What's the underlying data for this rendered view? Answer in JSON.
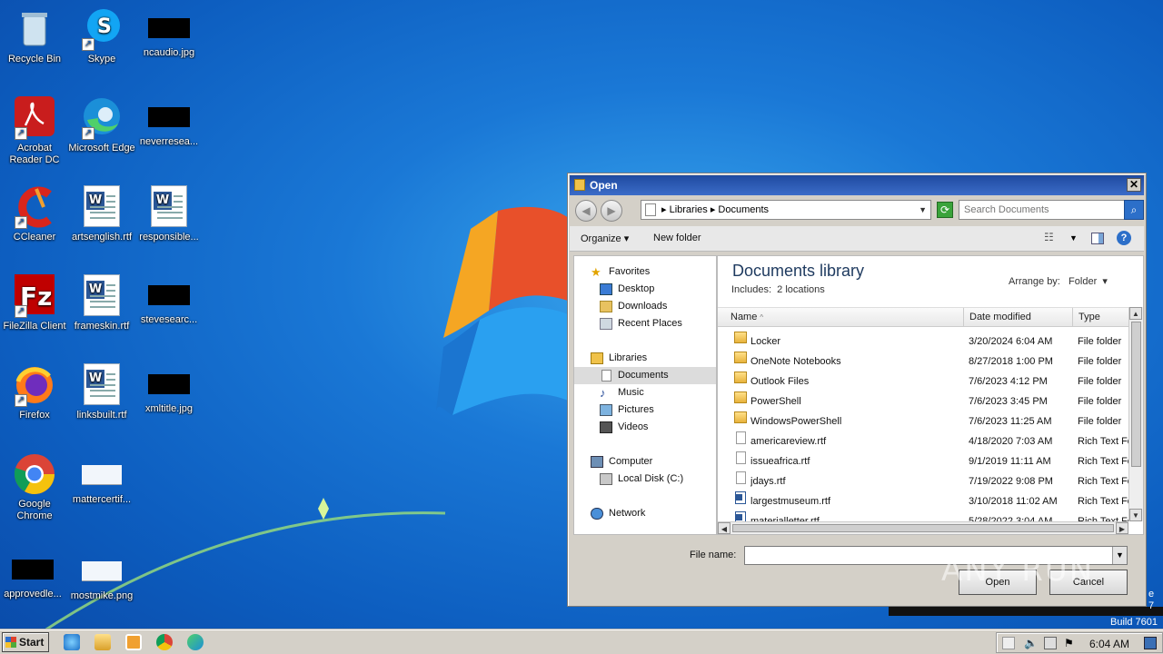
{
  "desktop": {
    "icons": [
      {
        "label": "Recycle Bin"
      },
      {
        "label": "Skype"
      },
      {
        "label": "ncaudio.jpg"
      },
      {
        "label": "Acrobat Reader DC"
      },
      {
        "label": "Microsoft Edge"
      },
      {
        "label": "neverresea..."
      },
      {
        "label": "CCleaner"
      },
      {
        "label": "artsenglish.rtf"
      },
      {
        "label": "responsible..."
      },
      {
        "label": "FileZilla Client"
      },
      {
        "label": "frameskin.rtf"
      },
      {
        "label": "stevesearc..."
      },
      {
        "label": "Firefox"
      },
      {
        "label": "linksbuilt.rtf"
      },
      {
        "label": "xmltitle.jpg"
      },
      {
        "label": "Google Chrome"
      },
      {
        "label": "mattercertif..."
      },
      {
        "label": "approvedle..."
      },
      {
        "label": "mostmike.png"
      }
    ]
  },
  "dialog": {
    "title": "Open",
    "close": "✕",
    "breadcrumb": [
      "Libraries",
      "Documents"
    ],
    "search_placeholder": "Search Documents",
    "toolbar": {
      "organize": "Organize",
      "new_folder": "New folder"
    },
    "nav": {
      "favorites": "Favorites",
      "desktop": "Desktop",
      "downloads": "Downloads",
      "recent": "Recent Places",
      "libraries": "Libraries",
      "documents": "Documents",
      "music": "Music",
      "pictures": "Pictures",
      "videos": "Videos",
      "computer": "Computer",
      "local_disk": "Local Disk (C:)",
      "network": "Network"
    },
    "library": {
      "title": "Documents library",
      "includes_label": "Includes:",
      "includes_value": "2 locations",
      "arrange_label": "Arrange by:",
      "arrange_value": "Folder"
    },
    "columns": {
      "name": "Name",
      "date": "Date modified",
      "type": "Type"
    },
    "files": [
      {
        "name": "Locker",
        "date": "3/20/2024 6:04 AM",
        "type": "File folder",
        "icon": "folder"
      },
      {
        "name": "OneNote Notebooks",
        "date": "8/27/2018 1:00 PM",
        "type": "File folder",
        "icon": "folder"
      },
      {
        "name": "Outlook Files",
        "date": "7/6/2023 4:12 PM",
        "type": "File folder",
        "icon": "folder"
      },
      {
        "name": "PowerShell",
        "date": "7/6/2023 3:45 PM",
        "type": "File folder",
        "icon": "folder"
      },
      {
        "name": "WindowsPowerShell",
        "date": "7/6/2023 11:25 AM",
        "type": "File folder",
        "icon": "folder"
      },
      {
        "name": "americareview.rtf",
        "date": "4/18/2020 7:03 AM",
        "type": "Rich Text Fo",
        "icon": "rtf"
      },
      {
        "name": "issueafrica.rtf",
        "date": "9/1/2019 11:11 AM",
        "type": "Rich Text Fo",
        "icon": "rtf"
      },
      {
        "name": "jdays.rtf",
        "date": "7/19/2022 9:08 PM",
        "type": "Rich Text Fo",
        "icon": "rtf"
      },
      {
        "name": "largestmuseum.rtf",
        "date": "3/10/2018 11:02 AM",
        "type": "Rich Text Fo",
        "icon": "word"
      },
      {
        "name": "materialletter.rtf",
        "date": "5/28/2022 3:04 AM",
        "type": "Rich Text Fo",
        "icon": "word"
      }
    ],
    "file_name_label": "File name:",
    "file_name_value": "",
    "open_button": "Open",
    "cancel_button": "Cancel"
  },
  "watermark": "ANY RUN",
  "build_text": "Build 7601",
  "side_text": "e\n7",
  "taskbar": {
    "start": "Start",
    "clock": "6:04 AM"
  }
}
